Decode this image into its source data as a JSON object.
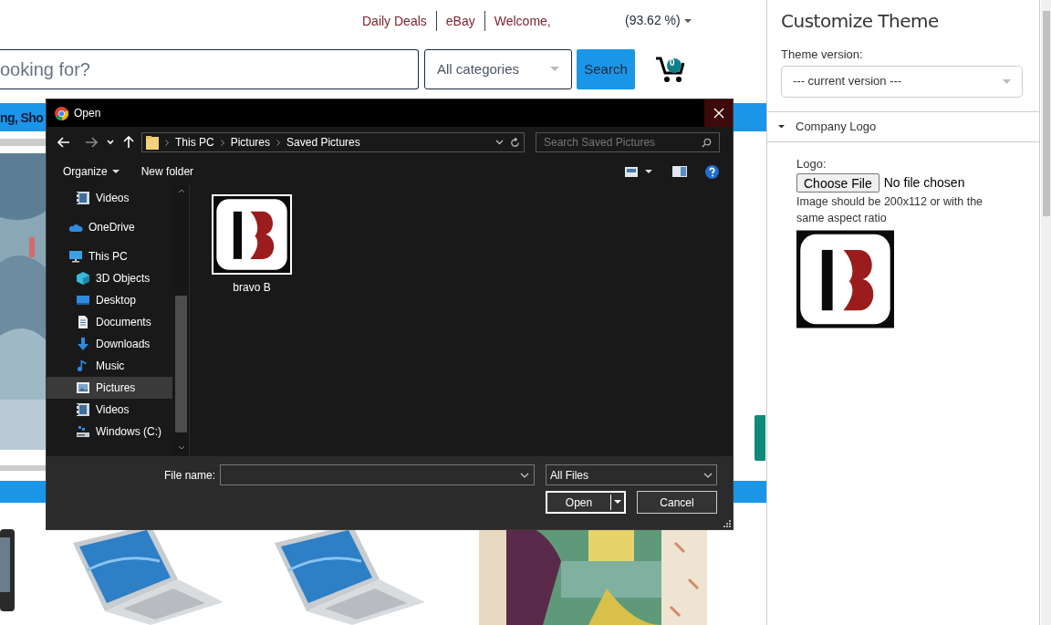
{
  "site": {
    "top_links": [
      {
        "label": "Daily Deals"
      },
      {
        "label": "eBay"
      },
      {
        "label": "Welcome,"
      }
    ],
    "balance": "(93.62 %)",
    "search": {
      "placeholder": "ooking for?"
    },
    "category": "All categories",
    "search_button": "Search",
    "cart_count": "0",
    "nav_text": "ng, Sho"
  },
  "dialog": {
    "title": "Open",
    "path": [
      "This PC",
      "Pictures",
      "Saved Pictures"
    ],
    "search": {
      "placeholder": "Search Saved Pictures"
    },
    "toolbar": [
      "Organize",
      "New folder"
    ],
    "nav": [
      {
        "children": [
          {
            "label": "Videos",
            "kind": "video",
            "selected": false
          }
        ]
      },
      {
        "label": "OneDrive",
        "kind": "cloud",
        "selected": false
      },
      {
        "label": "This PC",
        "kind": "pc",
        "selected": false,
        "children": [
          {
            "label": "3D Objects",
            "kind": "cube",
            "selected": false
          },
          {
            "label": "Desktop",
            "kind": "desktop",
            "selected": false
          },
          {
            "label": "Documents",
            "kind": "document",
            "selected": false
          },
          {
            "label": "Downloads",
            "kind": "download",
            "selected": false
          },
          {
            "label": "Music",
            "kind": "music",
            "selected": false
          },
          {
            "label": "Pictures",
            "kind": "picture",
            "selected": true
          },
          {
            "label": "Videos",
            "kind": "video",
            "selected": false
          },
          {
            "label": "Windows (C:)",
            "kind": "drive",
            "selected": false
          }
        ]
      }
    ],
    "files": [
      {
        "name": "bravo B",
        "selected": false
      }
    ],
    "file_name_label": "File name:",
    "file_type": "All Files",
    "buttons": [
      {
        "label": "Open",
        "kind": "split"
      },
      {
        "label": "Cancel",
        "kind": "plain"
      }
    ]
  },
  "panel": {
    "title": "Customize Theme",
    "theme_version": {
      "label": "Theme version:",
      "value": "--- current version ---"
    },
    "section": {
      "title": "Company Logo",
      "expanded": true,
      "logo_label": "Logo:",
      "choose_button": "Choose File",
      "file_status": "No file chosen",
      "hint": "Image should be 200x112 or with the same aspect ratio"
    }
  }
}
